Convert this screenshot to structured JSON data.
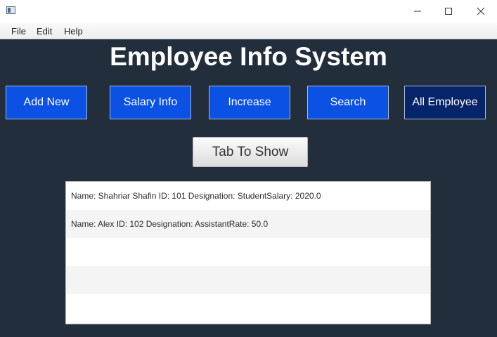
{
  "window": {
    "icon": "app-window-icon",
    "controls": [
      "minimize-icon",
      "maximize-icon",
      "close-icon"
    ]
  },
  "menu": {
    "items": [
      "File",
      "Edit",
      "Help"
    ]
  },
  "main": {
    "title": "Employee Info System",
    "nav_buttons": [
      "Add New",
      "Salary Info",
      "Increase",
      "Search",
      "All Employee"
    ],
    "tab_button": "Tab To Show",
    "employee_list": [
      "Name: Shahriar Shafin ID: 101 Designation: StudentSalary: 2020.0",
      "Name: Alex ID: 102 Designation: AssistantRate: 50.0",
      "",
      "",
      ""
    ]
  },
  "colors": {
    "background": "#232e3d",
    "button_blue": "#0b52e4",
    "button_dark_blue": "#05246a"
  }
}
